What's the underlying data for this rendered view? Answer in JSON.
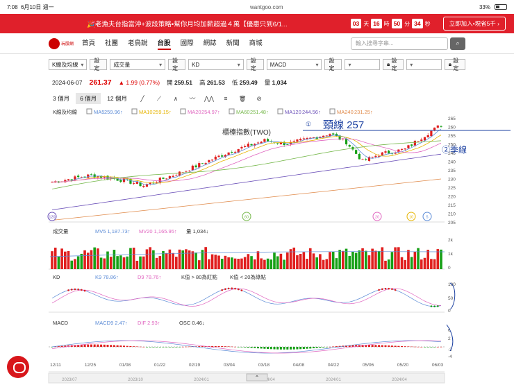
{
  "status": {
    "time": "7:08",
    "date": "6月10日 週一",
    "url": "wantgoo.com",
    "battery": "33%"
  },
  "promo": {
    "text": "🎉老漁夫台指當沖+波段策略•幫你月均加薪超過４萬【優惠只到6/1...",
    "countdown": [
      {
        "v": "03",
        "u": "天"
      },
      {
        "v": "16",
        "u": "時"
      },
      {
        "v": "50",
        "u": "分"
      },
      {
        "v": "34",
        "u": "秒"
      }
    ],
    "join": "立即加入•現省5千 ›"
  },
  "nav": {
    "logo": "玩股網",
    "items": [
      "首頁",
      "社團",
      "老鳥說",
      "台股",
      "國際",
      "網誌",
      "新聞",
      "商城"
    ],
    "active": "台股",
    "search_placeholder": "輸入搜尋字串..."
  },
  "selectors": {
    "s1": "K線及均線",
    "s2": "成交量",
    "s3": "KD",
    "s4": "MACD",
    "set": "設定"
  },
  "quote": {
    "date": "2024-06-07",
    "price": "261.37",
    "change": "▲ 1.99 (0.77%)",
    "open_label": "開",
    "open": "259.51",
    "high_label": "高",
    "high": "261.53",
    "low_label": "低",
    "low": "259.49",
    "vol_label": "量",
    "vol": "1,034"
  },
  "ranges": [
    "3 個月",
    "6 個月",
    "12 個月"
  ],
  "active_range": "6 個月",
  "colors": {
    "up": "#e01e1e",
    "down": "#16a016",
    "ma5": "#5b8bd6",
    "ma10": "#e6b400",
    "ma20": "#e066c0",
    "ma60": "#76b84b",
    "ma120": "#6a4fb8",
    "ma240": "#e08a4a"
  },
  "panels": {
    "k": {
      "title": "K線及均線",
      "ma": [
        {
          "n": "MA5",
          "v": "259.96↑",
          "c": "#5b8bd6"
        },
        {
          "n": "MA10",
          "v": "259.15↑",
          "c": "#e6b400"
        },
        {
          "n": "MA20",
          "v": "254.97↑",
          "c": "#e066c0"
        },
        {
          "n": "MA60",
          "v": "251.48↑",
          "c": "#76b84b"
        },
        {
          "n": "MA120",
          "v": "244.56↑",
          "c": "#6a4fb8"
        },
        {
          "n": "MA240",
          "v": "231.25↑",
          "c": "#e08a4a"
        }
      ],
      "chart_title": "櫃檯指數(TWO)",
      "y_ticks": [
        "265",
        "260",
        "255",
        "250",
        "245",
        "240",
        "235",
        "230",
        "225",
        "220",
        "215",
        "210",
        "205"
      ]
    },
    "vol": {
      "title": "成交量",
      "mv5": "MV5 1,187.73↑",
      "mv20": "MV20 1,165.95↑",
      "vol": "量 1,034↓",
      "y_ticks": [
        "2k",
        "1k",
        "0"
      ]
    },
    "kd": {
      "title": "KD",
      "k9": "K9 78.86↑",
      "d9": "D9 78.76↑",
      "n1": "K值 > 80為紅點",
      "n2": "K值 < 20為綠點",
      "y_ticks": [
        "100",
        "50",
        "0"
      ]
    },
    "macd": {
      "title": "MACD",
      "macd9": "MACD9 2.47↑",
      "dif": "DIF 2.93↑",
      "osc": "OSC 0.46↓",
      "y_ticks": [
        "6",
        "2",
        "-2",
        "-4"
      ]
    }
  },
  "x_ticks": [
    "12/11",
    "12/25",
    "01/08",
    "01/22",
    "02/19",
    "03/04",
    "03/18",
    "04/08",
    "04/22",
    "05/06",
    "05/20",
    "06/03"
  ],
  "nav_ticks": [
    "2023/07",
    "2023/10",
    "2024/01",
    "2024/04",
    "2024/01",
    "2024/04"
  ],
  "badges": [
    "120",
    "60",
    "20",
    "10",
    "5"
  ],
  "annotations": {
    "note1": "頸線 257",
    "note2": "②季線"
  }
}
